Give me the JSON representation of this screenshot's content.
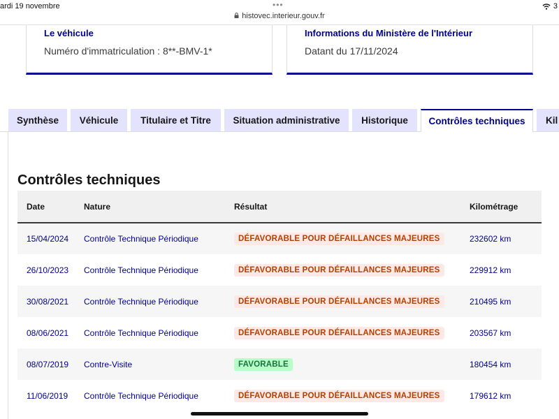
{
  "status_bar": {
    "date": "ardi 19 novembre",
    "url": "histovec.interieur.gouv.fr",
    "battery": "3"
  },
  "cards": [
    {
      "title": "Le véhicule",
      "text": "Numéro d'immatriculation : 8**-BMV-1*"
    },
    {
      "title": "Informations du Ministère de l'Intérieur",
      "text": "Datant du 17/11/2024"
    }
  ],
  "tabs": [
    {
      "label": "Synthèse"
    },
    {
      "label": "Véhicule"
    },
    {
      "label": "Titulaire et Titre"
    },
    {
      "label": "Situation administrative"
    },
    {
      "label": "Historique"
    },
    {
      "label": "Contrôles techniques"
    },
    {
      "label": "Kil"
    }
  ],
  "active_tab": "Contrôles techniques",
  "section_title": "Contrôles techniques",
  "table": {
    "headers": [
      "Date",
      "Nature",
      "Résultat",
      "Kilométrage"
    ],
    "rows": [
      {
        "date": "15/04/2024",
        "nature": "Contrôle Technique Périodique",
        "result": "DÉFAVORABLE POUR DÉFAILLANCES MAJEURES",
        "status": "bad",
        "km": "232602 km"
      },
      {
        "date": "26/10/2023",
        "nature": "Contrôle Technique Périodique",
        "result": "DÉFAVORABLE POUR DÉFAILLANCES MAJEURES",
        "status": "bad",
        "km": "229912 km"
      },
      {
        "date": "30/08/2021",
        "nature": "Contrôle Technique Périodique",
        "result": "DÉFAVORABLE POUR DÉFAILLANCES MAJEURES",
        "status": "bad",
        "km": "210495 km"
      },
      {
        "date": "08/06/2021",
        "nature": "Contrôle Technique Périodique",
        "result": "DÉFAVORABLE POUR DÉFAILLANCES MAJEURES",
        "status": "bad",
        "km": "203567 km"
      },
      {
        "date": "08/07/2019",
        "nature": "Contre-Visite",
        "result": "FAVORABLE",
        "status": "good",
        "km": "180454 km"
      },
      {
        "date": "11/06/2019",
        "nature": "Contrôle Technique Périodique",
        "result": "DÉFAVORABLE POUR DÉFAILLANCES MAJEURES",
        "status": "bad",
        "km": "179612 km"
      }
    ]
  },
  "colors": {
    "primary": "#000091",
    "tab_bg": "#e3e3fd",
    "bad_bg": "#ffe9e6",
    "bad_text": "#b34000",
    "good_bg": "#b8fec9",
    "good_text": "#18753c"
  }
}
